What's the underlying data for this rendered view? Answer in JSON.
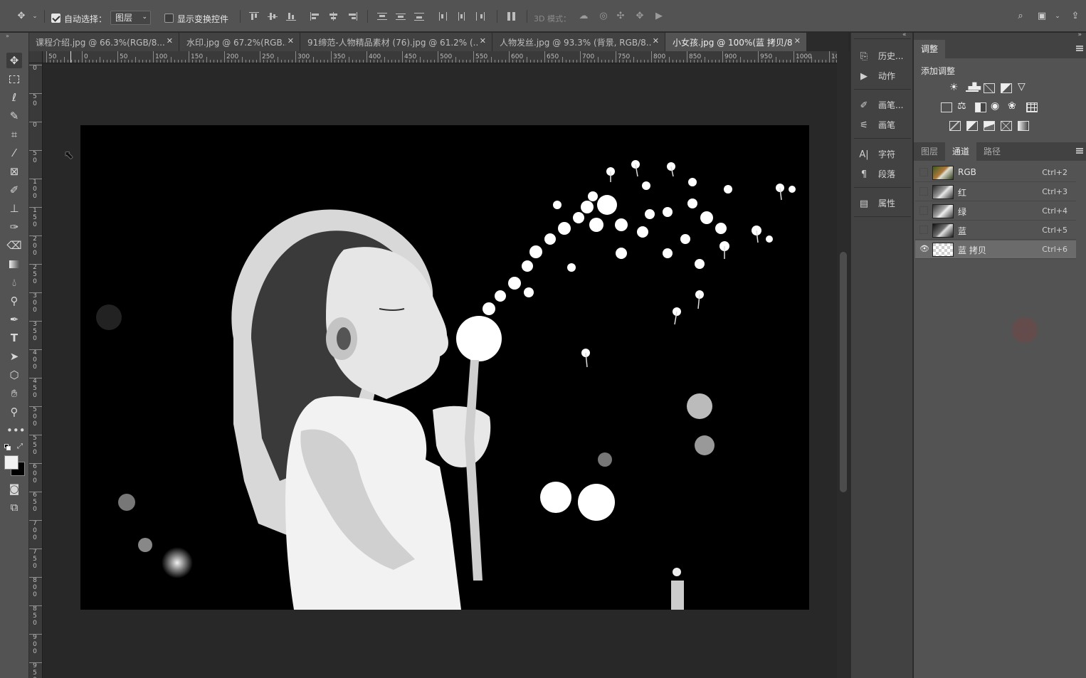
{
  "options_bar": {
    "auto_select_label": "自动选择：",
    "auto_select_checked": true,
    "auto_select_target": "图层",
    "show_transform_label": "显示变换控件",
    "show_transform_checked": false,
    "mode_3d_label": "3D 模式："
  },
  "tabs": [
    {
      "label": "课程介绍.jpg @ 66.3%(RGB/8...",
      "active": false
    },
    {
      "label": "水印.jpg @ 67.2%(RGB...",
      "active": false
    },
    {
      "label": "91缔范-人物精品素材 (76).jpg @ 61.2% (...",
      "active": false
    },
    {
      "label": "人物发丝.jpg @ 93.3% (背景, RGB/8...",
      "active": false
    },
    {
      "label": "小女孩.jpg @ 100%(蓝 拷贝/8) *",
      "active": true
    }
  ],
  "ruler_h": [
    "50",
    "0",
    "50",
    "100",
    "150",
    "200",
    "250",
    "300",
    "350",
    "400",
    "450",
    "500",
    "550",
    "600",
    "650",
    "700",
    "750",
    "800",
    "850",
    "900",
    "950",
    "1000",
    "10"
  ],
  "ruler_v": [
    "0",
    "5 0",
    "0",
    "5 0",
    "1 0 0",
    "1 5 0",
    "2 0 0",
    "2 5 0",
    "3 0 0",
    "3 5 0",
    "4 0 0",
    "4 5 0",
    "5 0 0",
    "5 5 0",
    "6 0 0",
    "6 5 0",
    "7 0 0",
    "7 5 0",
    "8 0 0",
    "8 5 0",
    "9 0 0",
    "9 5 0"
  ],
  "mid_panel": {
    "items": [
      "历史...",
      "动作",
      "画笔...",
      "画笔",
      "字符",
      "段落",
      "属性"
    ]
  },
  "adjustments": {
    "tab_label": "调整",
    "add_label": "添加调整"
  },
  "channels_panel": {
    "tabs": [
      "图层",
      "通道",
      "路径"
    ],
    "active_tab": "通道",
    "rows": [
      {
        "name": "RGB",
        "shortcut": "Ctrl+2",
        "visible": false,
        "active": false
      },
      {
        "name": "红",
        "shortcut": "Ctrl+3",
        "visible": false,
        "active": false
      },
      {
        "name": "绿",
        "shortcut": "Ctrl+4",
        "visible": false,
        "active": false
      },
      {
        "name": "蓝",
        "shortcut": "Ctrl+5",
        "visible": false,
        "active": false
      },
      {
        "name": "蓝 拷贝",
        "shortcut": "Ctrl+6",
        "visible": true,
        "active": true
      }
    ]
  },
  "colors": {
    "foreground": "#f2f2f2",
    "background": "#000000",
    "panel": "#535353",
    "canvas_bg": "#282828"
  }
}
